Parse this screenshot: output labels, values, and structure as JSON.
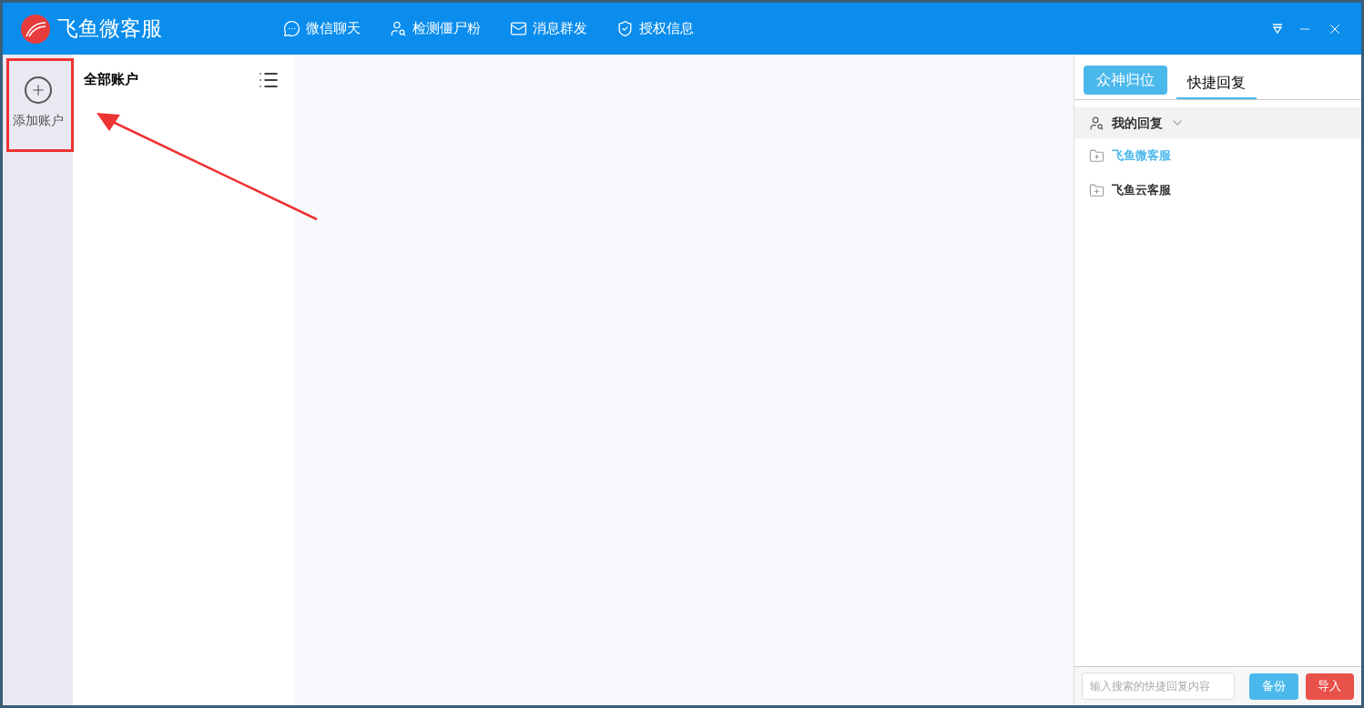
{
  "app": {
    "title": "飞鱼微客服"
  },
  "nav": [
    {
      "label": "微信聊天",
      "kind": "chat"
    },
    {
      "label": "检测僵尸粉",
      "kind": "detect"
    },
    {
      "label": "消息群发",
      "kind": "mail"
    },
    {
      "label": "授权信息",
      "kind": "shield"
    }
  ],
  "sidebar": {
    "add_label": "添加账户"
  },
  "accounts": {
    "title": "全部账户"
  },
  "reply_panel": {
    "action_button": "众神归位",
    "tabs": [
      {
        "label": "快捷回复",
        "selected": true
      }
    ],
    "group": {
      "label": "我的回复",
      "expanded": true
    },
    "folders": [
      {
        "label": "飞鱼微客服",
        "selected": true
      },
      {
        "label": "飞鱼云客服",
        "selected": false
      }
    ],
    "search": {
      "placeholder": "输入搜索的快捷回复内容"
    },
    "buttons": [
      {
        "label": "备份",
        "kind": "primary"
      },
      {
        "label": "导入",
        "kind": "danger"
      }
    ]
  }
}
